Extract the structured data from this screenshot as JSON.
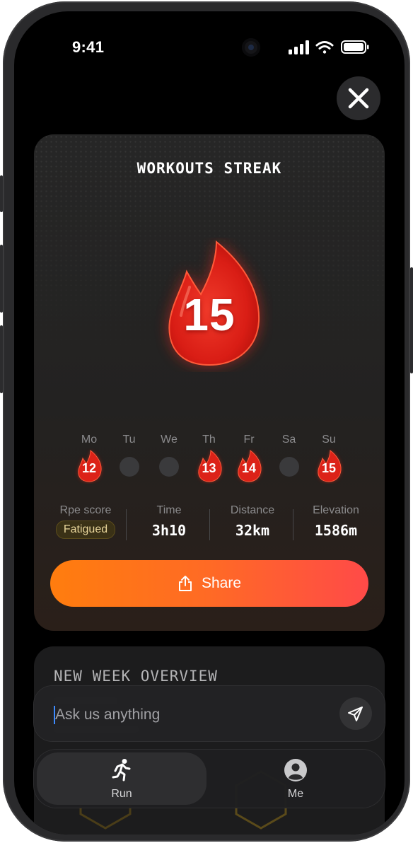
{
  "status_bar": {
    "time": "9:41"
  },
  "streak": {
    "title": "WORKOUTS STREAK",
    "count": "15",
    "days": [
      {
        "label": "Mo",
        "active": true,
        "value": "12"
      },
      {
        "label": "Tu",
        "active": false,
        "value": ""
      },
      {
        "label": "We",
        "active": false,
        "value": ""
      },
      {
        "label": "Th",
        "active": true,
        "value": "13"
      },
      {
        "label": "Fr",
        "active": true,
        "value": "14"
      },
      {
        "label": "Sa",
        "active": false,
        "value": ""
      },
      {
        "label": "Su",
        "active": true,
        "value": "15"
      }
    ],
    "stats": {
      "rpe": {
        "label": "Rpe score",
        "value": "Fatigued"
      },
      "time": {
        "label": "Time",
        "value": "3h10"
      },
      "distance": {
        "label": "Distance",
        "value": "32km"
      },
      "elevation": {
        "label": "Elevation",
        "value": "1586m"
      }
    },
    "share_label": "Share"
  },
  "overview": {
    "title": "NEW WEEK OVERVIEW"
  },
  "ask": {
    "placeholder": "Ask us anything"
  },
  "tabbar": {
    "run_label": "Run",
    "me_label": "Me"
  },
  "colors": {
    "flame_red": "#e5261c",
    "share_gradient_start": "#ff7d0e",
    "share_gradient_end": "#ff4a48",
    "badge_text": "#e7d49a"
  }
}
